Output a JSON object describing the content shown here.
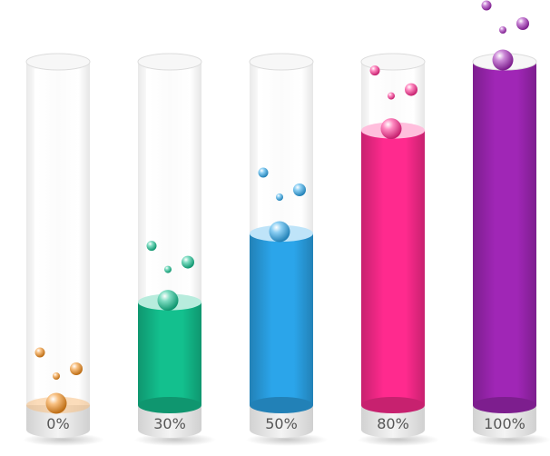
{
  "chart_data": {
    "type": "bar",
    "categories": [
      "0%",
      "30%",
      "50%",
      "80%",
      "100%"
    ],
    "values": [
      0,
      30,
      50,
      80,
      100
    ],
    "ylim": [
      0,
      100
    ],
    "title": "",
    "xlabel": "",
    "ylabel": "",
    "grid": false,
    "legend": "none",
    "colors": [
      "#F28C1A",
      "#13C08E",
      "#2BA5EA",
      "#FF2A8E",
      "#A026B6"
    ]
  }
}
